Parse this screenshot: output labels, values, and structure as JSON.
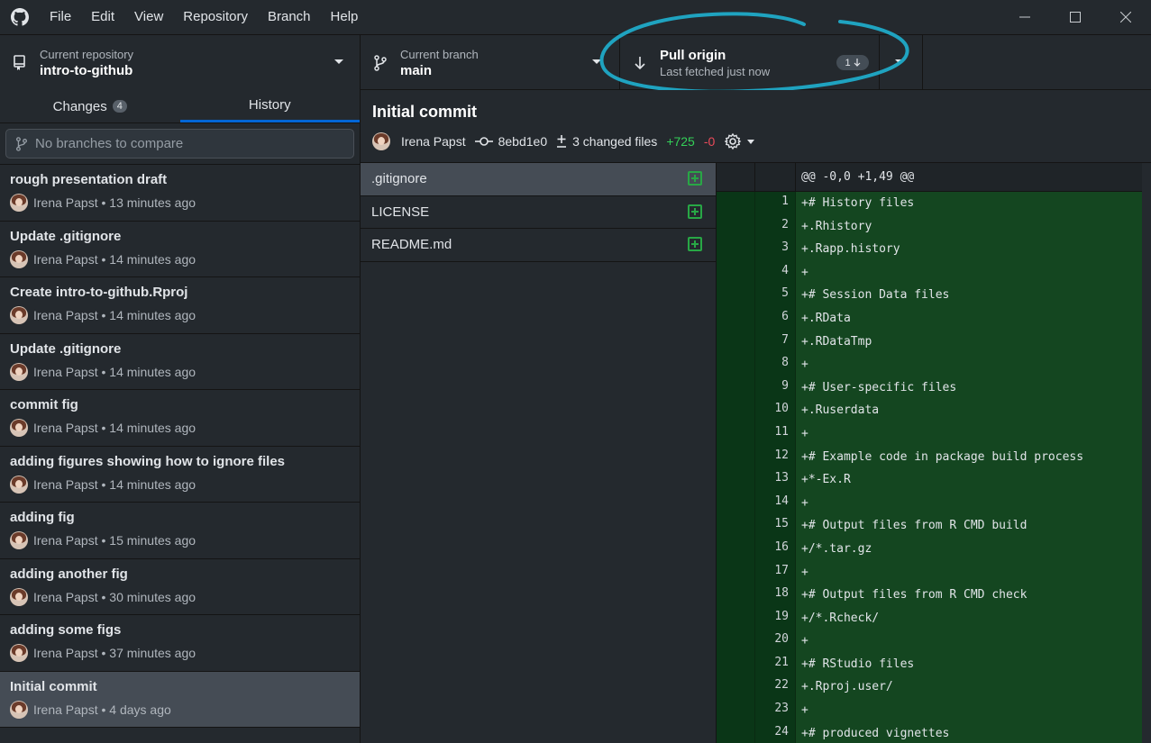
{
  "titlebar": {
    "menu": [
      "File",
      "Edit",
      "View",
      "Repository",
      "Branch",
      "Help"
    ]
  },
  "toolbar": {
    "repo_label": "Current repository",
    "repo_value": "intro-to-github",
    "branch_label": "Current branch",
    "branch_value": "main",
    "pull_label": "Pull origin",
    "pull_sub": "Last fetched just now",
    "pull_count": "1"
  },
  "sidebar": {
    "tab_changes": "Changes",
    "tab_changes_count": "4",
    "tab_history": "History",
    "compare_placeholder": "No branches to compare",
    "commits": [
      {
        "summary": "rough presentation draft",
        "meta": "Irena Papst • 13 minutes ago"
      },
      {
        "summary": "Update .gitignore",
        "meta": "Irena Papst • 14 minutes ago"
      },
      {
        "summary": "Create intro-to-github.Rproj",
        "meta": "Irena Papst • 14 minutes ago"
      },
      {
        "summary": "Update .gitignore",
        "meta": "Irena Papst • 14 minutes ago"
      },
      {
        "summary": "commit fig",
        "meta": "Irena Papst • 14 minutes ago"
      },
      {
        "summary": "adding figures showing how to ignore files",
        "meta": "Irena Papst • 14 minutes ago"
      },
      {
        "summary": "adding fig",
        "meta": "Irena Papst • 15 minutes ago"
      },
      {
        "summary": "adding another fig",
        "meta": "Irena Papst • 30 minutes ago"
      },
      {
        "summary": "adding some figs",
        "meta": "Irena Papst • 37 minutes ago"
      },
      {
        "summary": "Initial commit",
        "meta": "Irena Papst • 4 days ago"
      }
    ]
  },
  "commit": {
    "title": "Initial commit",
    "author": "Irena Papst",
    "sha": "8ebd1e0",
    "changed_files": "3 changed files",
    "additions": "+725",
    "deletions": "-0"
  },
  "files": [
    ".gitignore",
    "LICENSE",
    "README.md"
  ],
  "diff": {
    "hunk": "@@ -0,0 +1,49 @@",
    "lines": [
      {
        "n": "1",
        "text": "+# History files"
      },
      {
        "n": "2",
        "text": "+.Rhistory"
      },
      {
        "n": "3",
        "text": "+.Rapp.history"
      },
      {
        "n": "4",
        "text": "+"
      },
      {
        "n": "5",
        "text": "+# Session Data files"
      },
      {
        "n": "6",
        "text": "+.RData"
      },
      {
        "n": "7",
        "text": "+.RDataTmp"
      },
      {
        "n": "8",
        "text": "+"
      },
      {
        "n": "9",
        "text": "+# User-specific files"
      },
      {
        "n": "10",
        "text": "+.Ruserdata"
      },
      {
        "n": "11",
        "text": "+"
      },
      {
        "n": "12",
        "text": "+# Example code in package build process"
      },
      {
        "n": "13",
        "text": "+*-Ex.R"
      },
      {
        "n": "14",
        "text": "+"
      },
      {
        "n": "15",
        "text": "+# Output files from R CMD build"
      },
      {
        "n": "16",
        "text": "+/*.tar.gz"
      },
      {
        "n": "17",
        "text": "+"
      },
      {
        "n": "18",
        "text": "+# Output files from R CMD check"
      },
      {
        "n": "19",
        "text": "+/*.Rcheck/"
      },
      {
        "n": "20",
        "text": "+"
      },
      {
        "n": "21",
        "text": "+# RStudio files"
      },
      {
        "n": "22",
        "text": "+.Rproj.user/"
      },
      {
        "n": "23",
        "text": "+"
      },
      {
        "n": "24",
        "text": "+# produced vignettes"
      }
    ]
  },
  "colors": {
    "annotation": "#1fa3c0",
    "added": "#34d058",
    "deleted": "#ea4a5a",
    "accent": "#0366d6"
  }
}
